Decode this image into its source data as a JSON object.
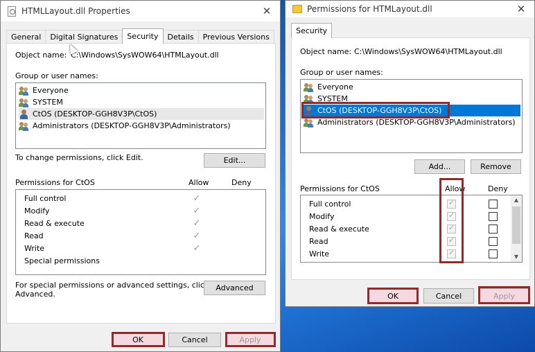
{
  "left_dialog": {
    "title": "HTMLLayout.dll Properties",
    "tabs": [
      "General",
      "Digital Signatures",
      "Security",
      "Details",
      "Previous Versions"
    ],
    "active_tab": "Security",
    "object_name_label": "Object name:",
    "object_name_value": "C:\\Windows\\SysWOW64\\HTMLayout.dll",
    "group_label": "Group or user names:",
    "users": [
      "Everyone",
      "SYSTEM",
      "CtOS (DESKTOP-GGH8V3P\\CtOS)",
      "Administrators (DESKTOP-GGH8V3P\\Administrators)"
    ],
    "change_text": "To change permissions, click Edit.",
    "edit_button": "Edit...",
    "permissions_for": "Permissions for CtOS",
    "allow_header": "Allow",
    "deny_header": "Deny",
    "permissions": [
      "Full control",
      "Modify",
      "Read & execute",
      "Read",
      "Write",
      "Special permissions"
    ],
    "special_text_1": "For special permissions or advanced settings, click",
    "special_text_2": "Advanced.",
    "advanced_button": "Advanced",
    "ok_button": "OK",
    "cancel_button": "Cancel",
    "apply_button": "Apply"
  },
  "right_dialog": {
    "title": "Permissions for HTMLayout.dll",
    "tab": "Security",
    "object_name_label": "Object name:",
    "object_name_value": "C:\\Windows\\SysWOW64\\HTMLayout.dll",
    "group_label": "Group or user names:",
    "users": [
      "Everyone",
      "SYSTEM",
      "CtOS (DESKTOP-GGH8V3P\\CtOS)",
      "Administrators (DESKTOP-GGH8V3P\\Administrators)"
    ],
    "add_button": "Add...",
    "remove_button": "Remove",
    "permissions_for": "Permissions for CtOS",
    "allow_header": "Allow",
    "deny_header": "Deny",
    "permissions": [
      "Full control",
      "Modify",
      "Read & execute",
      "Read",
      "Write"
    ],
    "ok_button": "OK",
    "cancel_button": "Cancel",
    "apply_button": "Apply"
  },
  "colors": {
    "highlight_box": "#8f2b2b",
    "selection_blue": "#0078d7"
  }
}
